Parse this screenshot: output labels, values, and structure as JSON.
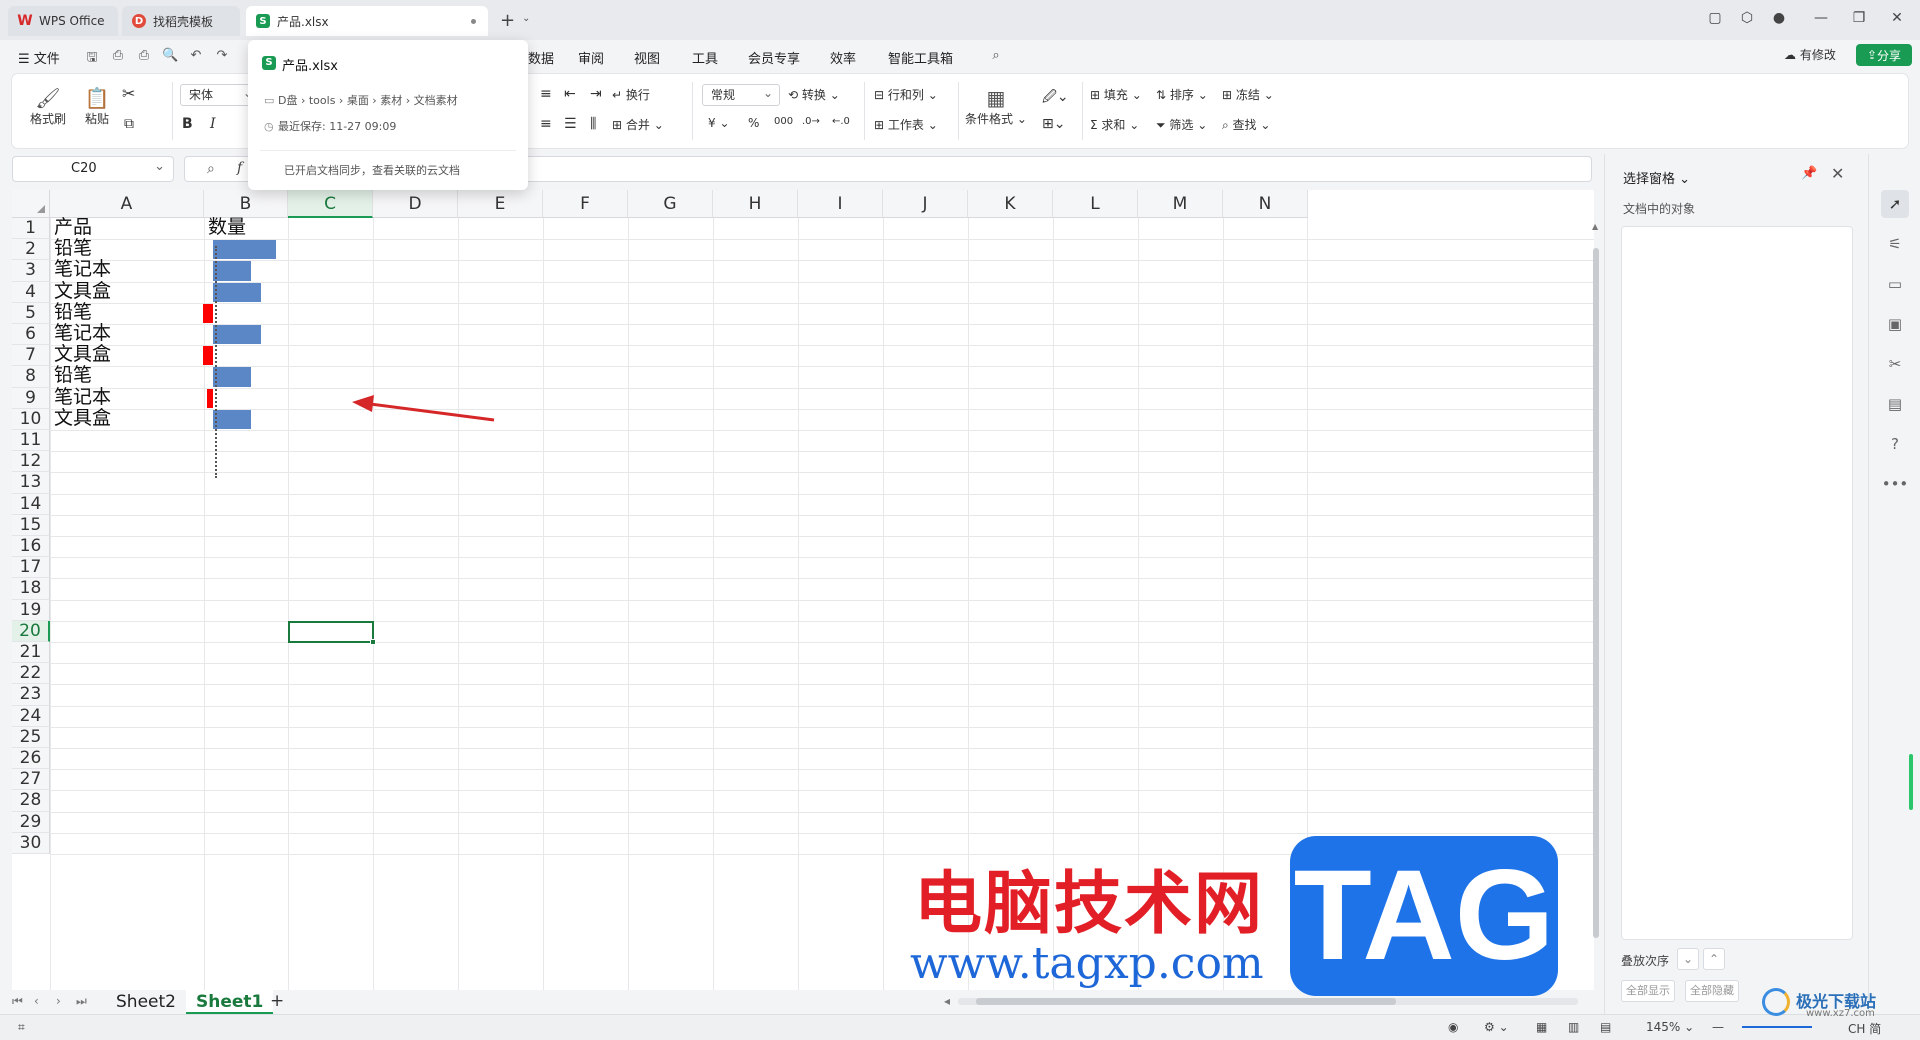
{
  "tabs": [
    {
      "label": "WPS Office",
      "icon": "wps-logo-icon"
    },
    {
      "label": "找稻壳模板",
      "icon": "docer-icon"
    },
    {
      "label": "产品.xlsx",
      "icon": "spreadsheet-icon",
      "active": true
    }
  ],
  "menu": {
    "file": "文件",
    "items": [
      "数据",
      "审阅",
      "视图",
      "工具",
      "会员专享",
      "效率",
      "智能工具箱"
    ],
    "modified": "有修改",
    "share": "分享"
  },
  "ribbon": {
    "format_painter": "格式刷",
    "paste": "粘贴",
    "font": "宋体",
    "bold": "B",
    "italic": "I",
    "wrap": "换行",
    "merge": "合并",
    "number_format": "常规",
    "convert": "转换",
    "rows_cols": "行和列",
    "worksheet": "工作表",
    "cond_format": "条件格式",
    "fill": "填充",
    "sort": "排序",
    "freeze": "冻结",
    "sum": "求和",
    "filter": "筛选",
    "find": "查找",
    "currency": "¥",
    "percent": "%"
  },
  "popup": {
    "filename": "产品.xlsx",
    "path": "D盘 › tools › 桌面 › 素材 › 文档素材",
    "saved": "最近保存: 11-27 09:09",
    "sync": "已开启文档同步，查看关联的云文档"
  },
  "namebox": "C20",
  "columns": [
    "A",
    "B",
    "C",
    "D",
    "E",
    "F",
    "G",
    "H",
    "I",
    "J",
    "K",
    "L",
    "M",
    "N"
  ],
  "selected_column": "C",
  "selected_row": 20,
  "cells": {
    "A1": "产品",
    "B1": "数量",
    "A2": "铅笔",
    "A3": "笔记本",
    "A4": "文具盒",
    "A5": "铅笔",
    "A6": "笔记本",
    "A7": "文具盒",
    "A8": "铅笔",
    "A9": "笔记本",
    "A10": "文具盒"
  },
  "data_bars": [
    {
      "row": 2,
      "value": 0.88,
      "color": "#5b87c7"
    },
    {
      "row": 3,
      "value": 0.53,
      "color": "#5b87c7"
    },
    {
      "row": 4,
      "value": 0.66,
      "color": "#5b87c7"
    },
    {
      "row": 5,
      "value": -0.25,
      "color": "#ff0000"
    },
    {
      "row": 6,
      "value": 0.66,
      "color": "#5b87c7"
    },
    {
      "row": 7,
      "value": -0.25,
      "color": "#ff0000"
    },
    {
      "row": 8,
      "value": 0.53,
      "color": "#5b87c7"
    },
    {
      "row": 9,
      "value": -0.15,
      "color": "#ff0000"
    },
    {
      "row": 10,
      "value": 0.53,
      "color": "#5b87c7"
    }
  ],
  "sheets": {
    "tab1": "Sheet2",
    "tab2": "Sheet1",
    "active": "Sheet1"
  },
  "pane": {
    "title": "选择窗格",
    "subtitle": "文档中的对象",
    "order": "叠放次序",
    "show_all": "全部显示",
    "hide_all": "全部隐藏"
  },
  "status": {
    "zoom": "145%",
    "lang": "CH",
    "ime": "简"
  },
  "watermark": {
    "cn": "电脑技术网",
    "url": "www.tagxp.com",
    "tag": "TAG",
    "jg": "极光下载站",
    "jg_url": "www.xz7.com"
  },
  "colors": {
    "accent": "#1a9b54",
    "bar_positive": "#5b87c7",
    "bar_negative": "#ff0000",
    "arrow": "#d62728"
  }
}
